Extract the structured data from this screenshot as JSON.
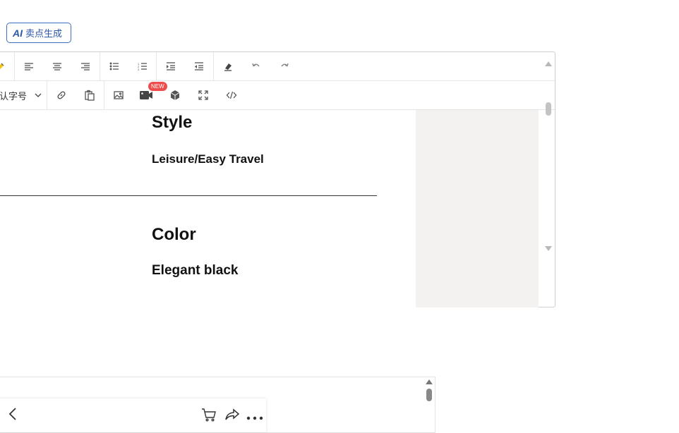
{
  "ai_button": {
    "icon": "AI",
    "label": "卖点生成"
  },
  "toolbar": {
    "font_size_label": "认字号",
    "new_badge": "NEW"
  },
  "content": {
    "heading_style": "Style",
    "text_style": "Leisure/Easy Travel",
    "heading_color": "Color",
    "text_color": "Elegant black"
  },
  "colors": {
    "accent": "#2c56a8",
    "badge": "#ee4d4d",
    "side_panel": "#f3f2f0"
  }
}
